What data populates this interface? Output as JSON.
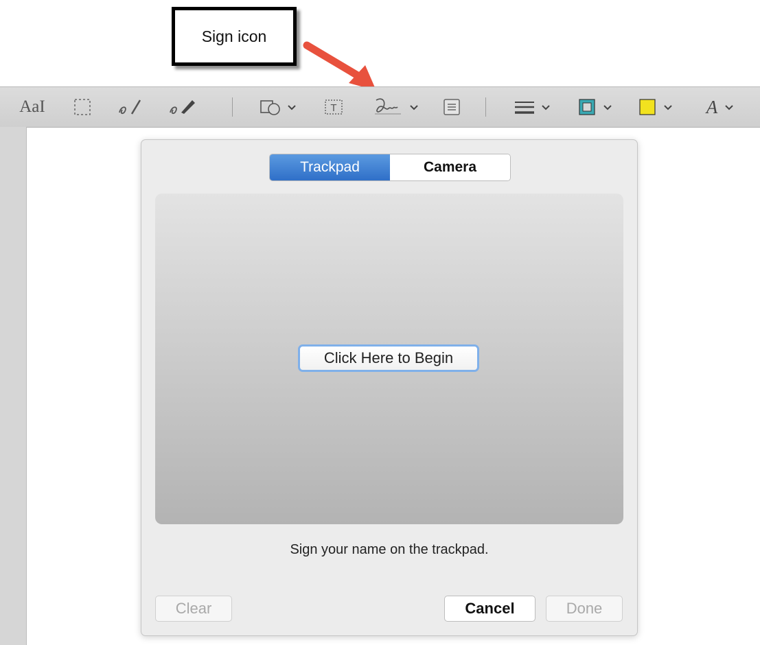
{
  "annotation": {
    "callout_label": "Sign icon",
    "arrow_color": "#e8513d"
  },
  "toolbar": {
    "text_style_label": "AaI",
    "font_label": "A",
    "icons": [
      "text-style-icon",
      "rectangular-selection-icon",
      "sketch-icon",
      "draw-icon",
      "shapes-icon",
      "text-box-icon",
      "sign-icon",
      "note-icon",
      "shape-style-icon",
      "border-color-icon",
      "fill-color-icon",
      "text-font-icon"
    ],
    "border_color": "#3aa9b3",
    "fill_color": "#f2e21f"
  },
  "signature_popover": {
    "tabs": [
      {
        "label": "Trackpad",
        "selected": true
      },
      {
        "label": "Camera",
        "selected": false
      }
    ],
    "begin_button": "Click Here to Begin",
    "instruction": "Sign your name on the trackpad.",
    "buttons": {
      "clear": "Clear",
      "cancel": "Cancel",
      "done": "Done"
    },
    "accent_color": "#3b7bd4"
  }
}
